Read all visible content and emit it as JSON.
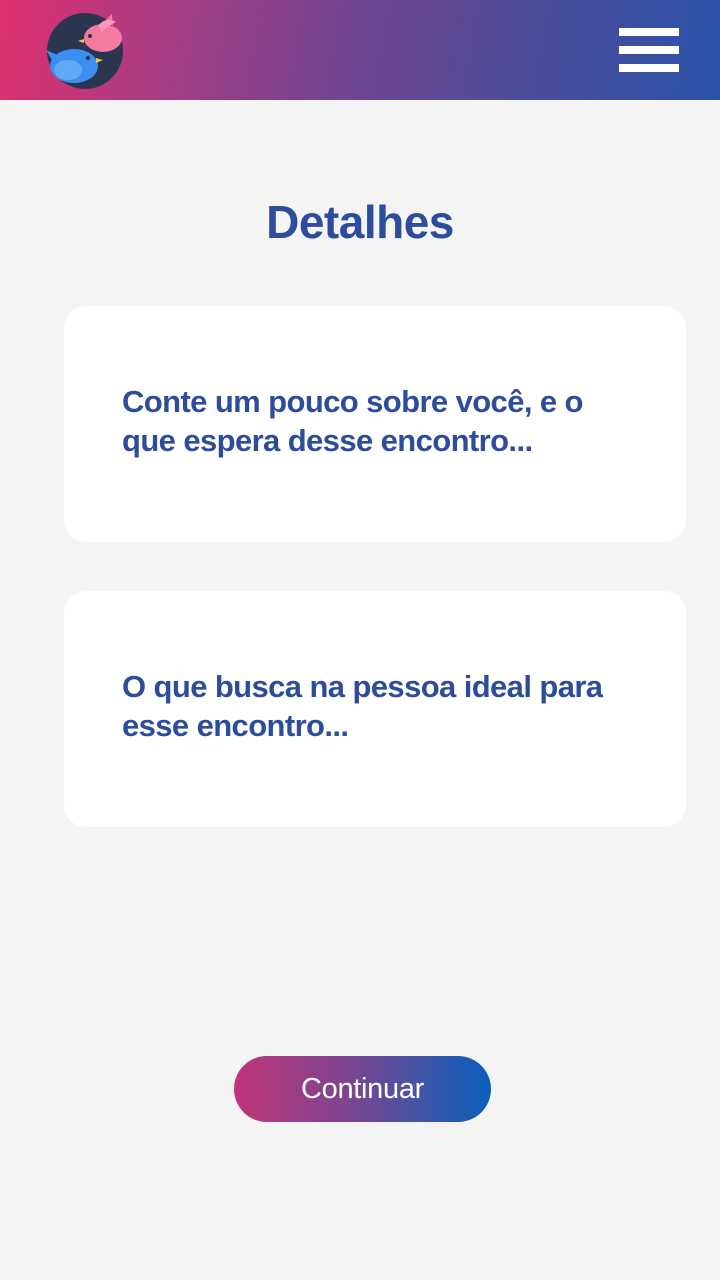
{
  "header": {
    "logo_icon": "two-birds-logo-icon",
    "menu_icon": "hamburger-menu-icon",
    "gradient_start": "#e0306e",
    "gradient_end": "#2a52a8"
  },
  "main": {
    "title": "Detalhes",
    "about_field": {
      "placeholder": "Conte um pouco sobre você, e o que espera desse encontro...",
      "value": ""
    },
    "ideal_field": {
      "placeholder": "O que busca na pessoa ideal para esse encontro...",
      "value": ""
    }
  },
  "footer": {
    "continue_label": "Continuar"
  },
  "colors": {
    "accent_text": "#2d4d9c",
    "background": "#f4f4f4",
    "card": "#ffffff"
  }
}
